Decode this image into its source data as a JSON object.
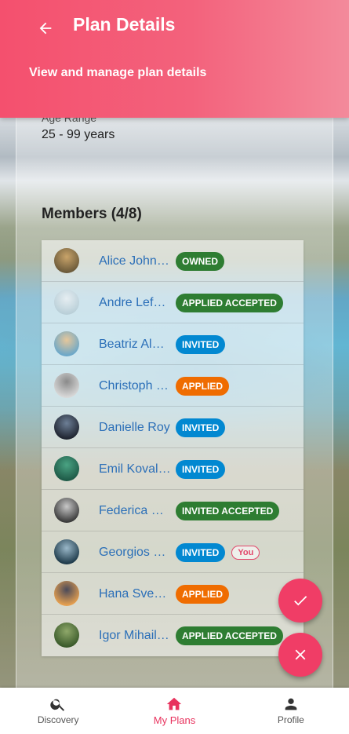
{
  "header": {
    "title": "Plan Details",
    "subtitle": "View and manage plan details"
  },
  "details": {
    "age_label": "Age Range",
    "age_value": "25 - 99 years"
  },
  "members": {
    "heading": "Members (4/8)",
    "items": [
      {
        "name": "Alice John…",
        "chips": [
          {
            "label": "OWNED",
            "color": "#2e7d32"
          }
        ]
      },
      {
        "name": "Andre Lefe…",
        "chips": [
          {
            "label": "APPLIED ACCEPTED",
            "color": "#2e7d32"
          }
        ]
      },
      {
        "name": "Beatriz Al…",
        "chips": [
          {
            "label": "INVITED",
            "color": "#0288d1"
          }
        ]
      },
      {
        "name": "Christoph …",
        "chips": [
          {
            "label": "APPLIED",
            "color": "#ef6c00"
          }
        ]
      },
      {
        "name": "Danielle Roy",
        "chips": [
          {
            "label": "INVITED",
            "color": "#0288d1"
          }
        ]
      },
      {
        "name": "Emil Koval…",
        "chips": [
          {
            "label": "INVITED",
            "color": "#0288d1"
          }
        ]
      },
      {
        "name": "Federica R…",
        "chips": [
          {
            "label": "INVITED ACCEPTED",
            "color": "#2e7d32"
          }
        ]
      },
      {
        "name": "Georgios …",
        "chips": [
          {
            "label": "INVITED",
            "color": "#0288d1"
          }
        ],
        "you": "You"
      },
      {
        "name": "Hana Sven…",
        "chips": [
          {
            "label": "APPLIED",
            "color": "#ef6c00"
          }
        ]
      },
      {
        "name": "Igor Mihail…",
        "chips": [
          {
            "label": "APPLIED ACCEPTED",
            "color": "#2e7d32"
          }
        ]
      }
    ]
  },
  "nav": {
    "items": [
      {
        "label": "Discovery",
        "icon": "search-icon"
      },
      {
        "label": "My Plans",
        "icon": "home-icon"
      },
      {
        "label": "Profile",
        "icon": "person-icon"
      }
    ],
    "active_color": "#e8335e"
  },
  "colors": {
    "accent": "#f03d66",
    "header_start": "#f4506e",
    "header_end": "#f38a9b",
    "link": "#2b6fb8"
  }
}
